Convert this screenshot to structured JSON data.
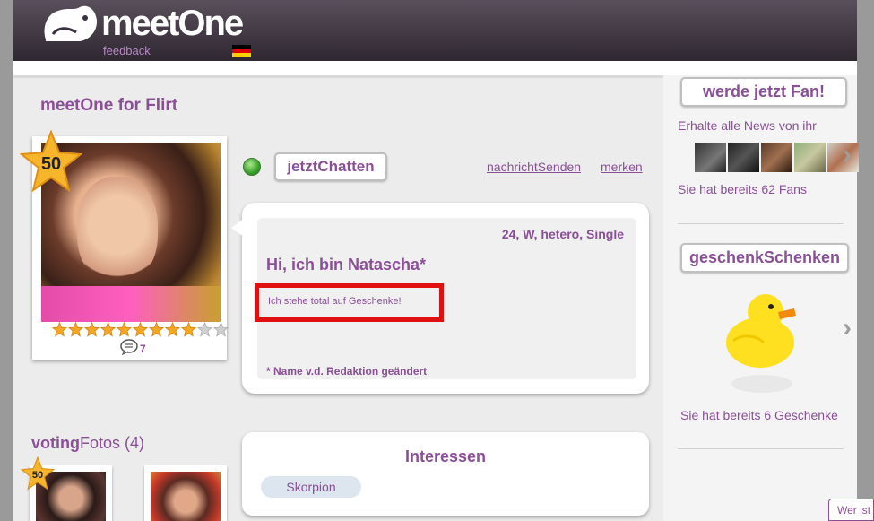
{
  "header": {
    "logo_text": "meetOne",
    "feedback_link": "feedback",
    "flag_icon": "germany-flag-icon"
  },
  "profile": {
    "section_title": "meetOne for Flirt",
    "score_badge": "50",
    "rating_stars_filled": 9,
    "rating_stars_total": 11,
    "comment_count": "7",
    "chat_button": "jetztChatten",
    "send_message_link": "nachrichtSenden",
    "remember_link": "merken",
    "meta": "24, W, hetero, Single",
    "greeting": "Hi, ich bin Natascha*",
    "bio": "Ich stehe total auf Geschenke!",
    "note": "* Name v.d. Redaktion geändert"
  },
  "voting": {
    "title_bold": "voting",
    "title_rest": "Fotos (4)",
    "first_badge": "50"
  },
  "interests": {
    "title": "Interessen",
    "tags": [
      "Skorpion"
    ]
  },
  "sidebar": {
    "fan_button": "werde jetzt Fan!",
    "fan_news": "Erhalte alle News von ihr",
    "fan_count": "Sie hat bereits 62 Fans",
    "gift_button": "geschenkSchenken",
    "gift_count": "Sie hat bereits 6 Geschenke"
  },
  "wer_ist": "Wer ist",
  "colors": {
    "accent": "#8a4f97",
    "highlight_box": "#e01010",
    "online": "#39a02a"
  }
}
